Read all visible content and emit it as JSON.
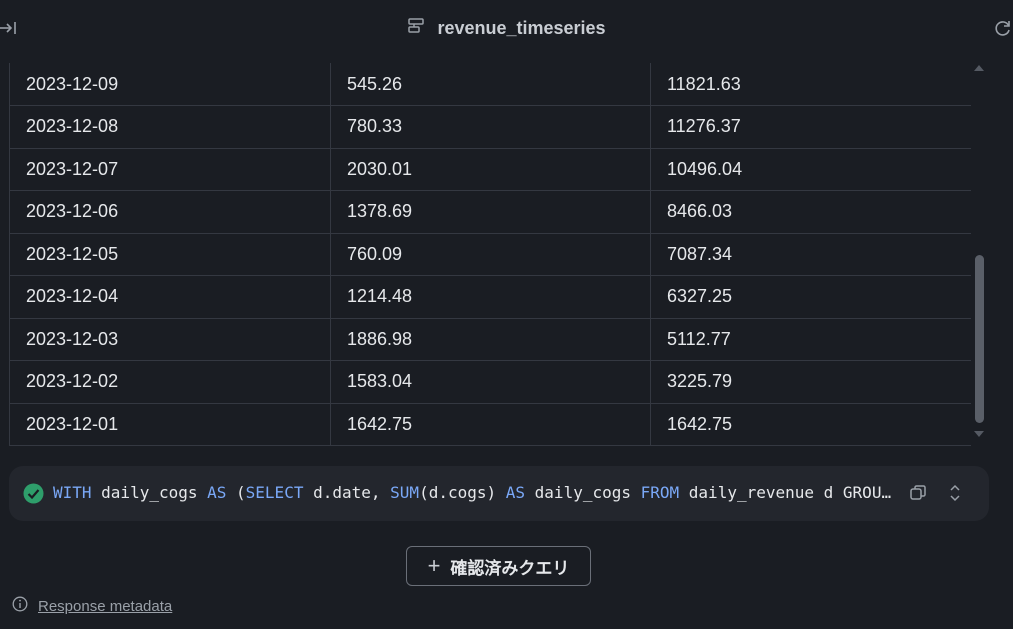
{
  "header": {
    "title": "revenue_timeseries",
    "icons": {
      "left": "collapse-panel-icon",
      "title": "table-icon",
      "right": "refresh-icon"
    }
  },
  "table": {
    "rows": [
      [
        "2023-12-09",
        "545.26",
        "11821.63"
      ],
      [
        "2023-12-08",
        "780.33",
        "11276.37"
      ],
      [
        "2023-12-07",
        "2030.01",
        "10496.04"
      ],
      [
        "2023-12-06",
        "1378.69",
        "8466.03"
      ],
      [
        "2023-12-05",
        "760.09",
        "7087.34"
      ],
      [
        "2023-12-04",
        "1214.48",
        "6327.25"
      ],
      [
        "2023-12-03",
        "1886.98",
        "5112.77"
      ],
      [
        "2023-12-02",
        "1583.04",
        "3225.79"
      ],
      [
        "2023-12-01",
        "1642.75",
        "1642.75"
      ]
    ]
  },
  "query": {
    "status": "success",
    "tokens": [
      {
        "t": "WITH",
        "kw": true
      },
      {
        "t": " daily_cogs ",
        "kw": false
      },
      {
        "t": "AS",
        "kw": true
      },
      {
        "t": " (",
        "kw": false
      },
      {
        "t": "SELECT",
        "kw": true
      },
      {
        "t": " d.date, ",
        "kw": false
      },
      {
        "t": "SUM",
        "kw": true
      },
      {
        "t": "(d.cogs) ",
        "kw": false
      },
      {
        "t": "AS",
        "kw": true
      },
      {
        "t": " daily_cogs ",
        "kw": false
      },
      {
        "t": "FROM",
        "kw": true
      },
      {
        "t": " daily_revenue d GROUP BY d.date)",
        "kw": false
      }
    ]
  },
  "actions": {
    "verified_query_label": "確認済みクエリ"
  },
  "footer": {
    "metadata_link": "Response metadata"
  },
  "colors": {
    "background": "#1a1d23",
    "keyword": "#7aa8f7",
    "success": "#2e9e6b"
  }
}
